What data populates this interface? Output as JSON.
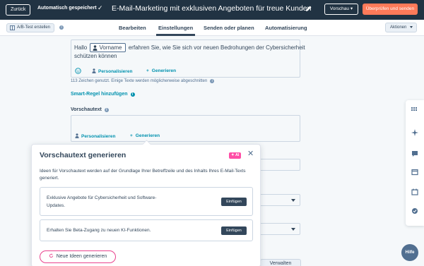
{
  "header": {
    "back_label": "Zurück",
    "autosave_label": "Automatisch gespeichert",
    "title": "E-Mail-Marketing mit exklusiven Angeboten für treue Kunden",
    "preview_label": "Vorschau",
    "review_send_label": "Überprüfen und senden"
  },
  "tabbar": {
    "ab_test_label": "A/B-Test erstellen",
    "tabs": [
      {
        "label": "Bearbeiten"
      },
      {
        "label": "Einstellungen"
      },
      {
        "label": "Senden oder planen"
      },
      {
        "label": "Automatisierung"
      }
    ],
    "active_tab": "Einstellungen",
    "actions_label": "Aktionen"
  },
  "subject": {
    "prefix": "Hallo",
    "token": "Vorname",
    "line1_rest": "erfahren Sie, wie Sie sich vor neuen Bedrohungen der Cybersicherheit",
    "line2": "schützen können",
    "personalize_label": "Personalisieren",
    "generate_label": "Generieren",
    "char_count_text": "113 Zeichen genutzt. Einige Texte werden möglicherweise abgeschnitten"
  },
  "smart_rule_label": "Smart-Regel hinzufügen",
  "preview_text": {
    "label": "Vorschautext",
    "personalize_label": "Personalisieren",
    "generate_label": "Generieren"
  },
  "manage_label": "Verwalten",
  "popover": {
    "title": "Vorschautext generieren",
    "ai_badge": "AI",
    "description": "Ideen für Vorschautext werden auf der Grundlage Ihrer Betreffzeile und des Inhalts Ihres E-Mail-Texts generiert.",
    "suggestions": [
      {
        "text": "Exklusive Angebote für Cybersicherheit und Software-Updates.",
        "button": "Einfügen"
      },
      {
        "text": "Erhalten Sie Beta-Zugang zu neuen KI-Funktionen.",
        "button": "Einfügen"
      }
    ],
    "new_ideas_label": "Neue Ideen generieren"
  },
  "help_label": "Hilfe",
  "colors": {
    "header_bg": "#213343",
    "accent_orange": "#ff7a59",
    "link_teal": "#0091ae",
    "ai_pink": "#ff4da6"
  }
}
